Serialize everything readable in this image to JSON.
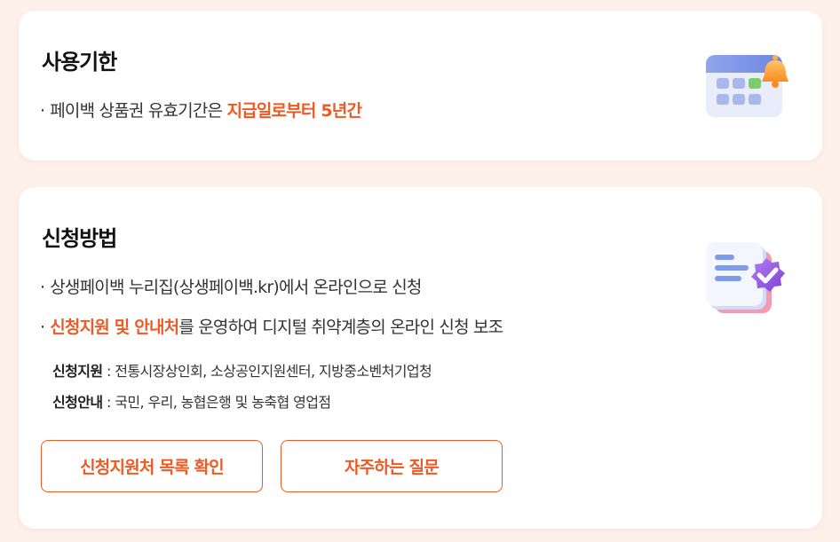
{
  "usage": {
    "title": "사용기한",
    "bullet": "·",
    "text_prefix": "페이백 상품권 유효기간은 ",
    "text_highlight": "지급일로부터 5년간",
    "icon": "calendar-bell-icon"
  },
  "apply": {
    "title": "신청방법",
    "bullet": "·",
    "line1": "상생페이백 누리집(상생페이백.kr)에서 온라인으로 신청",
    "line2_highlight": "신청지원 및 안내처",
    "line2_rest": "를 운영하여 디지털 취약계층의 온라인 신청 보조",
    "support_label": "신청지원",
    "support_value": " : 전통시장상인회, 소상공인지원센터, 지방중소벤처기업청",
    "guide_label": "신청안내",
    "guide_value": " : 국민, 우리, 농협은행 및 농축협 영업점",
    "icon": "document-verified-icon"
  },
  "buttons": {
    "support_list": "신청지원처 목록 확인",
    "faq": "자주하는 질문"
  },
  "colors": {
    "accent": "#ee5a24",
    "background": "#fdf1ea",
    "card": "#ffffff"
  }
}
